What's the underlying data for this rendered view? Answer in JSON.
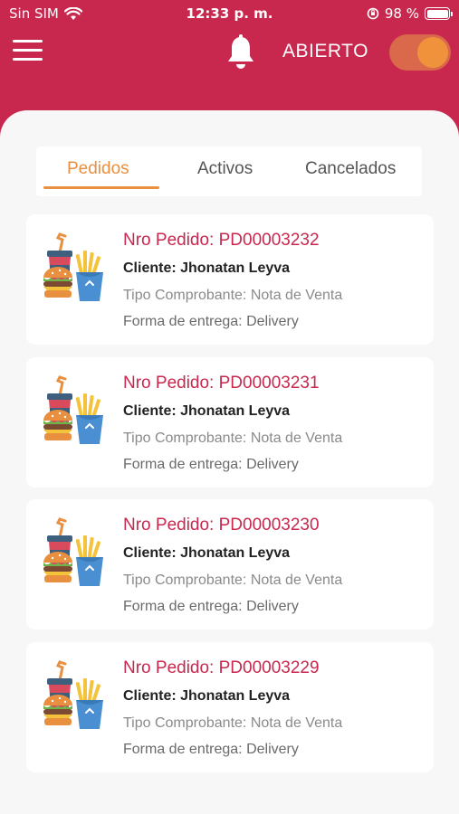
{
  "status_bar": {
    "carrier": "Sin SIM",
    "time": "12:33 p. m.",
    "battery": "98 %"
  },
  "header": {
    "status_label": "ABIERTO",
    "toggle_on": true,
    "accent_color": "#c8284e",
    "toggle_color": "#f0923c"
  },
  "tabs": [
    {
      "label": "Pedidos",
      "active": true
    },
    {
      "label": "Activos",
      "active": false
    },
    {
      "label": "Cancelados",
      "active": false
    }
  ],
  "orders": [
    {
      "order_no": "Nro Pedido: PD00003232",
      "client": "Cliente: Jhonatan Leyva",
      "receipt": "Tipo Comprobante: Nota de Venta",
      "delivery": "Forma de entrega: Delivery",
      "icon": "fast-food-icon"
    },
    {
      "order_no": "Nro Pedido: PD00003231",
      "client": "Cliente: Jhonatan Leyva",
      "receipt": "Tipo Comprobante: Nota de Venta",
      "delivery": "Forma de entrega: Delivery",
      "icon": "fast-food-icon"
    },
    {
      "order_no": "Nro Pedido: PD00003230",
      "client": "Cliente: Jhonatan Leyva",
      "receipt": "Tipo Comprobante: Nota de Venta",
      "delivery": "Forma de entrega: Delivery",
      "icon": "fast-food-icon"
    },
    {
      "order_no": "Nro Pedido: PD00003229",
      "client": "Cliente: Jhonatan Leyva",
      "receipt": "Tipo Comprobante: Nota de Venta",
      "delivery": "Forma de entrega: Delivery",
      "icon": "fast-food-icon"
    }
  ]
}
